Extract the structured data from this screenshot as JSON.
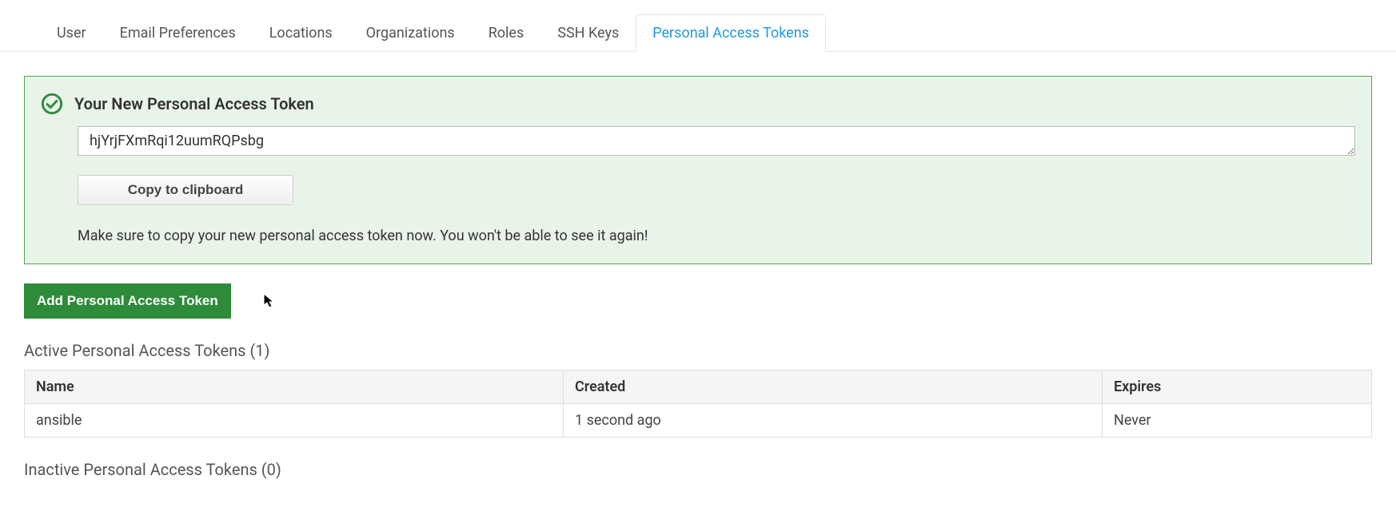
{
  "tabs": [
    {
      "label": "User"
    },
    {
      "label": "Email Preferences"
    },
    {
      "label": "Locations"
    },
    {
      "label": "Organizations"
    },
    {
      "label": "Roles"
    },
    {
      "label": "SSH Keys"
    },
    {
      "label": "Personal Access Tokens"
    }
  ],
  "alert": {
    "title": "Your New Personal Access Token",
    "token": "hjYrjFXmRqi12uumRQPsbg",
    "copy_label": "Copy to clipboard",
    "note": "Make sure to copy your new personal access token now. You won't be able to see it again!"
  },
  "buttons": {
    "add": "Add Personal Access Token"
  },
  "active_section": {
    "title": "Active Personal Access Tokens (1)",
    "columns": {
      "name": "Name",
      "created": "Created",
      "expires": "Expires"
    },
    "rows": [
      {
        "name": "ansible",
        "created": "1 second ago",
        "expires": "Never"
      }
    ]
  },
  "inactive_section": {
    "title": "Inactive Personal Access Tokens (0)"
  }
}
